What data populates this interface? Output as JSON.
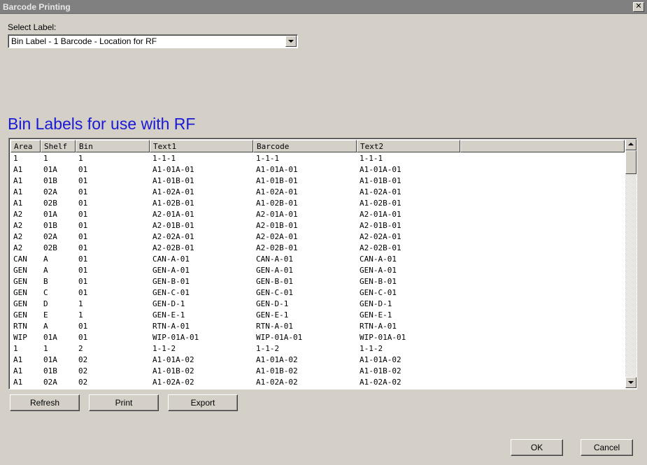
{
  "window": {
    "title": "Barcode Printing",
    "close_glyph": "✕"
  },
  "selector": {
    "label": "Select Label:",
    "value": "Bin Label - 1 Barcode - Location for RF"
  },
  "heading": "Bin Labels for use with RF",
  "table": {
    "columns": [
      "Area",
      "Shelf",
      "Bin",
      "Text1",
      "Barcode",
      "Text2"
    ],
    "rows": [
      [
        "1",
        "1",
        "1",
        "1-1-1",
        "1-1-1",
        "1-1-1"
      ],
      [
        "A1",
        "01A",
        "01",
        "A1-01A-01",
        "A1-01A-01",
        "A1-01A-01"
      ],
      [
        "A1",
        "01B",
        "01",
        "A1-01B-01",
        "A1-01B-01",
        "A1-01B-01"
      ],
      [
        "A1",
        "02A",
        "01",
        "A1-02A-01",
        "A1-02A-01",
        "A1-02A-01"
      ],
      [
        "A1",
        "02B",
        "01",
        "A1-02B-01",
        "A1-02B-01",
        "A1-02B-01"
      ],
      [
        "A2",
        "01A",
        "01",
        "A2-01A-01",
        "A2-01A-01",
        "A2-01A-01"
      ],
      [
        "A2",
        "01B",
        "01",
        "A2-01B-01",
        "A2-01B-01",
        "A2-01B-01"
      ],
      [
        "A2",
        "02A",
        "01",
        "A2-02A-01",
        "A2-02A-01",
        "A2-02A-01"
      ],
      [
        "A2",
        "02B",
        "01",
        "A2-02B-01",
        "A2-02B-01",
        "A2-02B-01"
      ],
      [
        "CAN",
        "A",
        "01",
        "CAN-A-01",
        "CAN-A-01",
        "CAN-A-01"
      ],
      [
        "GEN",
        "A",
        "01",
        "GEN-A-01",
        "GEN-A-01",
        "GEN-A-01"
      ],
      [
        "GEN",
        "B",
        "01",
        "GEN-B-01",
        "GEN-B-01",
        "GEN-B-01"
      ],
      [
        "GEN",
        "C",
        "01",
        "GEN-C-01",
        "GEN-C-01",
        "GEN-C-01"
      ],
      [
        "GEN",
        "D",
        "1",
        "GEN-D-1",
        "GEN-D-1",
        "GEN-D-1"
      ],
      [
        "GEN",
        "E",
        "1",
        "GEN-E-1",
        "GEN-E-1",
        "GEN-E-1"
      ],
      [
        "RTN",
        "A",
        "01",
        "RTN-A-01",
        "RTN-A-01",
        "RTN-A-01"
      ],
      [
        "WIP",
        "01A",
        "01",
        "WIP-01A-01",
        "WIP-01A-01",
        "WIP-01A-01"
      ],
      [
        "1",
        "1",
        "2",
        "1-1-2",
        "1-1-2",
        "1-1-2"
      ],
      [
        "A1",
        "01A",
        "02",
        "A1-01A-02",
        "A1-01A-02",
        "A1-01A-02"
      ],
      [
        "A1",
        "01B",
        "02",
        "A1-01B-02",
        "A1-01B-02",
        "A1-01B-02"
      ],
      [
        "A1",
        "02A",
        "02",
        "A1-02A-02",
        "A1-02A-02",
        "A1-02A-02"
      ]
    ]
  },
  "buttons": {
    "refresh": "Refresh",
    "print": "Print",
    "export": "Export",
    "ok": "OK",
    "cancel": "Cancel"
  },
  "colors": {
    "heading": "#1a1ad6",
    "dialog_bg": "#d4d0c8",
    "titlebar": "#808080"
  }
}
